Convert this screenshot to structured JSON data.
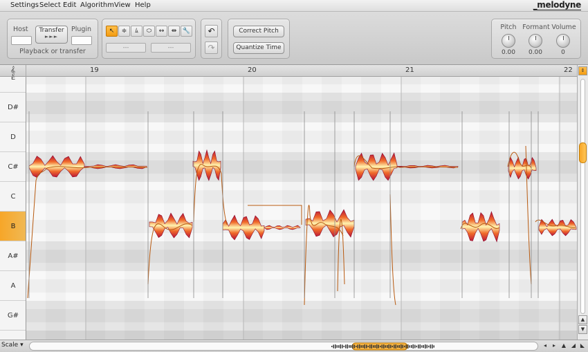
{
  "menu": [
    "Settings",
    "Select",
    "Edit",
    "Algorithm",
    "View",
    "Help"
  ],
  "brand": "_melodyne",
  "transport": {
    "host_label": "Host",
    "transfer_label": "Transfer",
    "transfer_arrows": "►►►",
    "plugin_label": "Plugin",
    "status": "Playback or transfer"
  },
  "tools": {
    "icons": [
      "arrow-tool-icon",
      "pitch-tool-icon",
      "formant-tool-icon",
      "amplitude-tool-icon",
      "timing-tool-icon",
      "note-separation-icon",
      "wrench-icon"
    ],
    "glyphs": [
      "↖",
      "≑",
      "ﾑ",
      "⬭",
      "↔",
      "⇹",
      "🔧"
    ],
    "field1": "---",
    "field2": "---"
  },
  "history": {
    "undo_glyph": "↶",
    "redo_glyph": "↷"
  },
  "actions": {
    "correct_pitch": "Correct Pitch",
    "quantize_time": "Quantize Time"
  },
  "knobs": [
    {
      "label": "Pitch",
      "value": "0.00"
    },
    {
      "label": "Formant",
      "value": "0.00"
    },
    {
      "label": "Volume",
      "value": "0"
    }
  ],
  "ruler": {
    "bars": [
      "19",
      "20",
      "21",
      "22"
    ]
  },
  "keyboard": {
    "notes": [
      "E",
      "D#",
      "D",
      "C#",
      "C",
      "B",
      "A#",
      "A",
      "G#"
    ],
    "active": "B"
  },
  "bottom": {
    "scale_label": "Scale"
  },
  "colors": {
    "accent": "#f39c12",
    "blob_inner": "#fff3b0",
    "blob_outer": "#b8123a",
    "pitch_line": "#b85a10"
  }
}
